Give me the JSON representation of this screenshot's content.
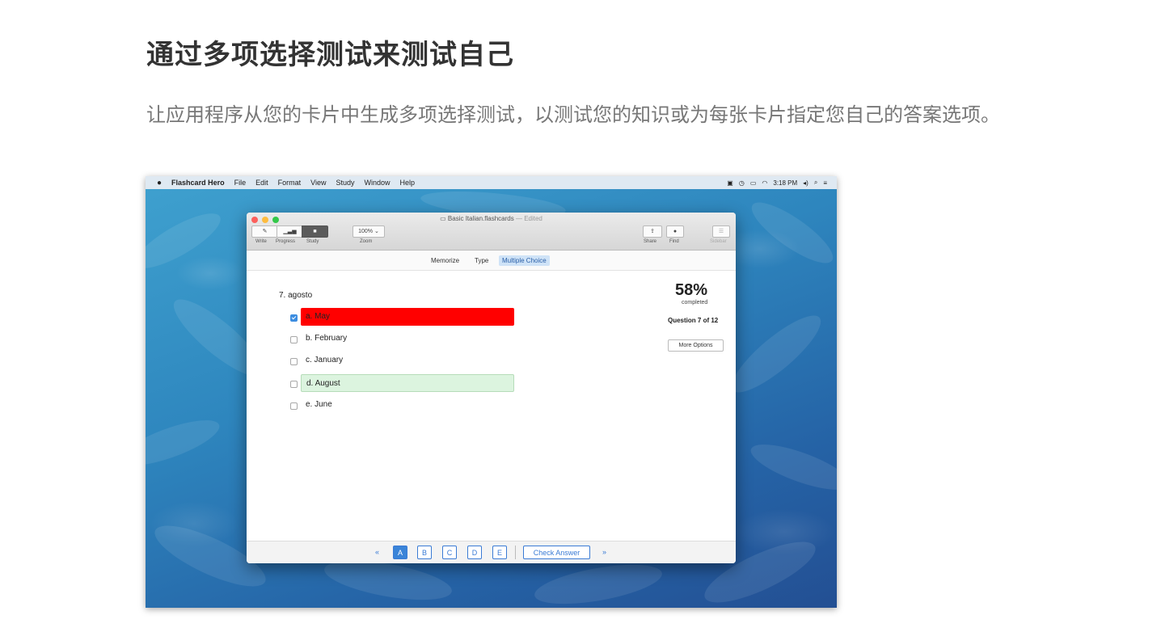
{
  "heading": "通过多项选择测试来测试自己",
  "description": "让应用程序从您的卡片中生成多项选择测试，以测试您的知识或为每张卡片指定您自己的答案选项。",
  "menubar": {
    "app_name": "Flashcard Hero",
    "items": [
      "File",
      "Edit",
      "Format",
      "View",
      "Study",
      "Window",
      "Help"
    ],
    "time": "3:18 PM"
  },
  "window": {
    "title": "Basic Italian.flashcards",
    "title_suffix": "— Edited",
    "toolbar": {
      "write_label": "Write",
      "progress_label": "Progress",
      "study_label": "Study",
      "zoom_value": "100%",
      "zoom_label": "Zoom",
      "share_label": "Share",
      "find_label": "Find",
      "sidebar_label": "Sidebar"
    },
    "modes": [
      {
        "label": "Memorize",
        "active": false
      },
      {
        "label": "Type",
        "active": false
      },
      {
        "label": "Multiple Choice",
        "active": true
      }
    ]
  },
  "quiz": {
    "question": "7. agosto",
    "options": [
      {
        "label": "a. May",
        "checked": true,
        "state": "wrong"
      },
      {
        "label": "b. February",
        "checked": false,
        "state": "none"
      },
      {
        "label": "c. January",
        "checked": false,
        "state": "none"
      },
      {
        "label": "d. August",
        "checked": false,
        "state": "correct"
      },
      {
        "label": "e. June",
        "checked": false,
        "state": "none"
      }
    ],
    "percent": "58%",
    "percent_value": 58,
    "completed_label": "completed",
    "question_progress": "Question 7 of 12",
    "more_options_label": "More Options"
  },
  "footer": {
    "prev": "«",
    "next": "»",
    "answer_buttons": [
      "A",
      "B",
      "C",
      "D",
      "E"
    ],
    "selected": "A",
    "check_answer_label": "Check Answer"
  },
  "colors": {
    "wrong": "#ff0000",
    "correct": "#dcf4df",
    "accent": "#3a84d8"
  }
}
